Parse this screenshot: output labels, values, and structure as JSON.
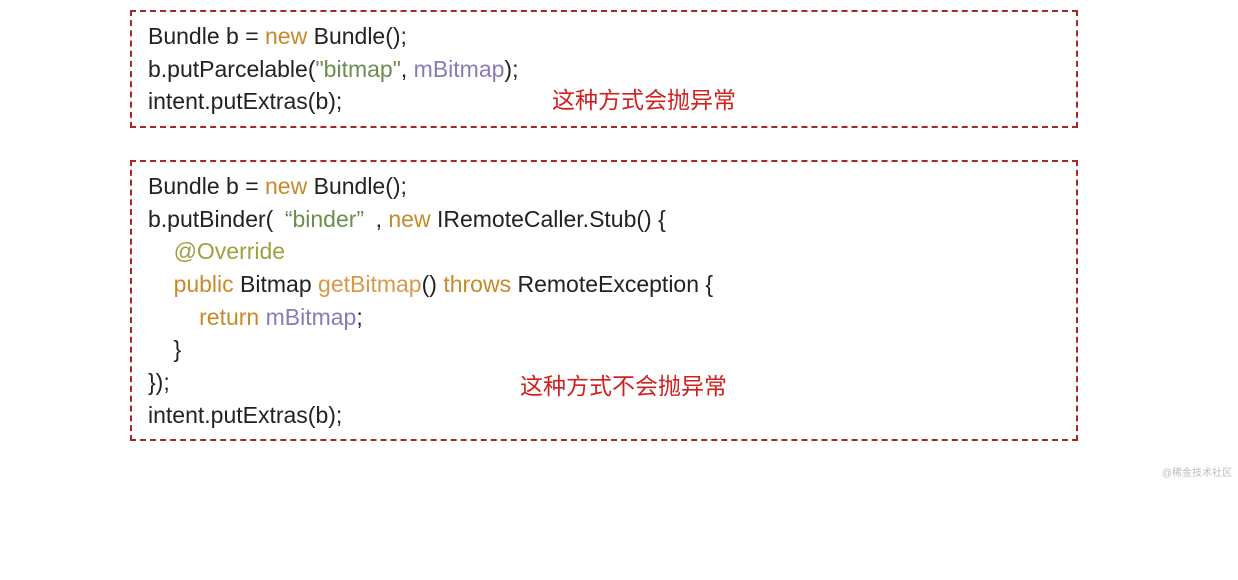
{
  "box1": {
    "l1_a": "Bundle b = ",
    "l1_new": "new",
    "l1_b": " Bundle();",
    "l2_a": "b.putParcelable(",
    "l2_str": "\"bitmap\"",
    "l2_b": ", ",
    "l2_var": "mBitmap",
    "l2_c": ");",
    "l3": "intent.putExtras(b);",
    "annotation": "这种方式会抛异常"
  },
  "box2": {
    "l1_a": "Bundle b = ",
    "l1_new": "new",
    "l1_b": " Bundle();",
    "l2_a": "b.putBinder( ",
    "l2_str": "“binder”",
    "l2_b": " , ",
    "l2_new": "new",
    "l2_c": " IRemoteCaller.Stub() {",
    "l3_pad": "    ",
    "l3_ann": "@Override",
    "l4_pad": "    ",
    "l4_pub": "public",
    "l4_a": " Bitmap ",
    "l4_fn": "getBitmap",
    "l4_b": "() ",
    "l4_throws": "throws",
    "l4_c": " RemoteException {",
    "l5_pad": "        ",
    "l5_ret": "return",
    "l5_a": " ",
    "l5_var": "mBitmap",
    "l5_b": ";",
    "l6": "    }",
    "l7": "});",
    "l8": "intent.putExtras(b);",
    "annotation": "这种方式不会抛异常"
  },
  "watermark": "@稀金技术社区"
}
